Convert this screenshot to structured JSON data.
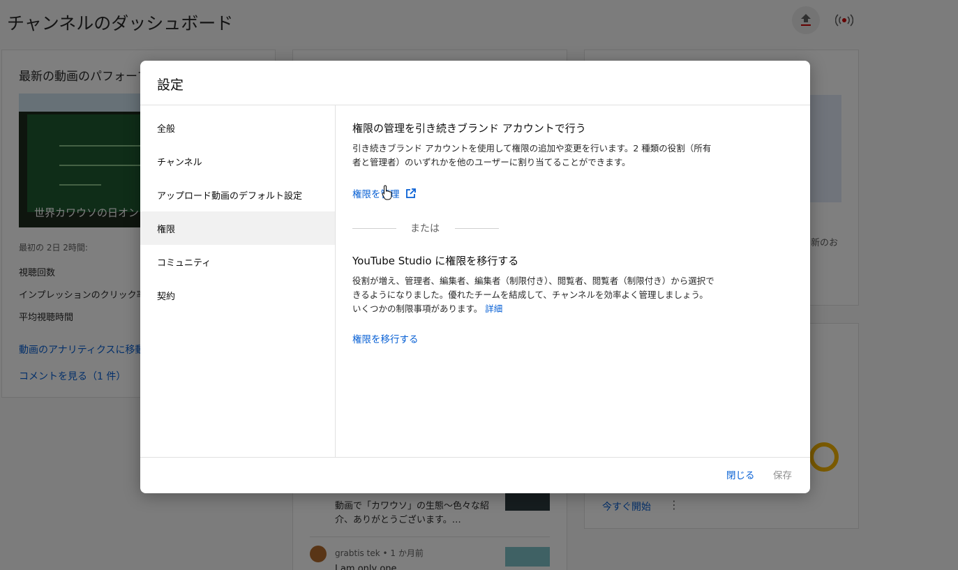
{
  "page": {
    "title": "チャンネルのダッシュボード"
  },
  "card_latest": {
    "heading": "最新の動画のパフォーマンス",
    "video_title": "世界カワウソの日オンライン",
    "meta": "最初の 2日 2時間:",
    "rows": [
      "視聴回数",
      "インプレッションのクリック率",
      "平均視聴時間"
    ],
    "links": [
      "動画のアナリティクスに移動",
      "コメントを見る（1 件）"
    ]
  },
  "card_right": {
    "text": "新のお",
    "start_label": "今すぐ開始"
  },
  "comments": [
    {
      "text": "動画で「カワウソ」の生態〜色々な紹介、ありがとうございます。…"
    },
    {
      "author": "grabtis tek • 1 か月前",
      "text": "I am only one"
    }
  ],
  "dialog": {
    "title": "設定",
    "nav": [
      "全般",
      "チャンネル",
      "アップロード動画のデフォルト設定",
      "権限",
      "コミュニティ",
      "契約"
    ],
    "active_nav": "権限",
    "section1": {
      "title": "権限の管理を引き続きブランド アカウントで行う",
      "body": "引き続きブランド アカウントを使用して権限の追加や変更を行います。2 種類の役割（所有者と管理者）のいずれかを他のユーザーに割り当てることができます。",
      "link": "権限を管理"
    },
    "divider_text": "または",
    "section2": {
      "title": "YouTube Studio に権限を移行する",
      "body": "役割が増え、管理者、編集者、編集者（制限付き）、閲覧者、閲覧者（制限付き）から選択できるようになりました。優れたチームを結成して、チャンネルを効率よく管理しましょう。いくつかの制限事項があります。",
      "details_link": "詳細",
      "link": "権限を移行する"
    },
    "buttons": {
      "close": "閉じる",
      "save": "保存"
    }
  },
  "colors": {
    "link": "#065fd4",
    "live_accent": "#cc0000",
    "active_nav_bg": "#f1f1f1"
  },
  "icons": [
    "upload-icon",
    "live-icon",
    "external-link-icon",
    "more-vert-icon"
  ]
}
